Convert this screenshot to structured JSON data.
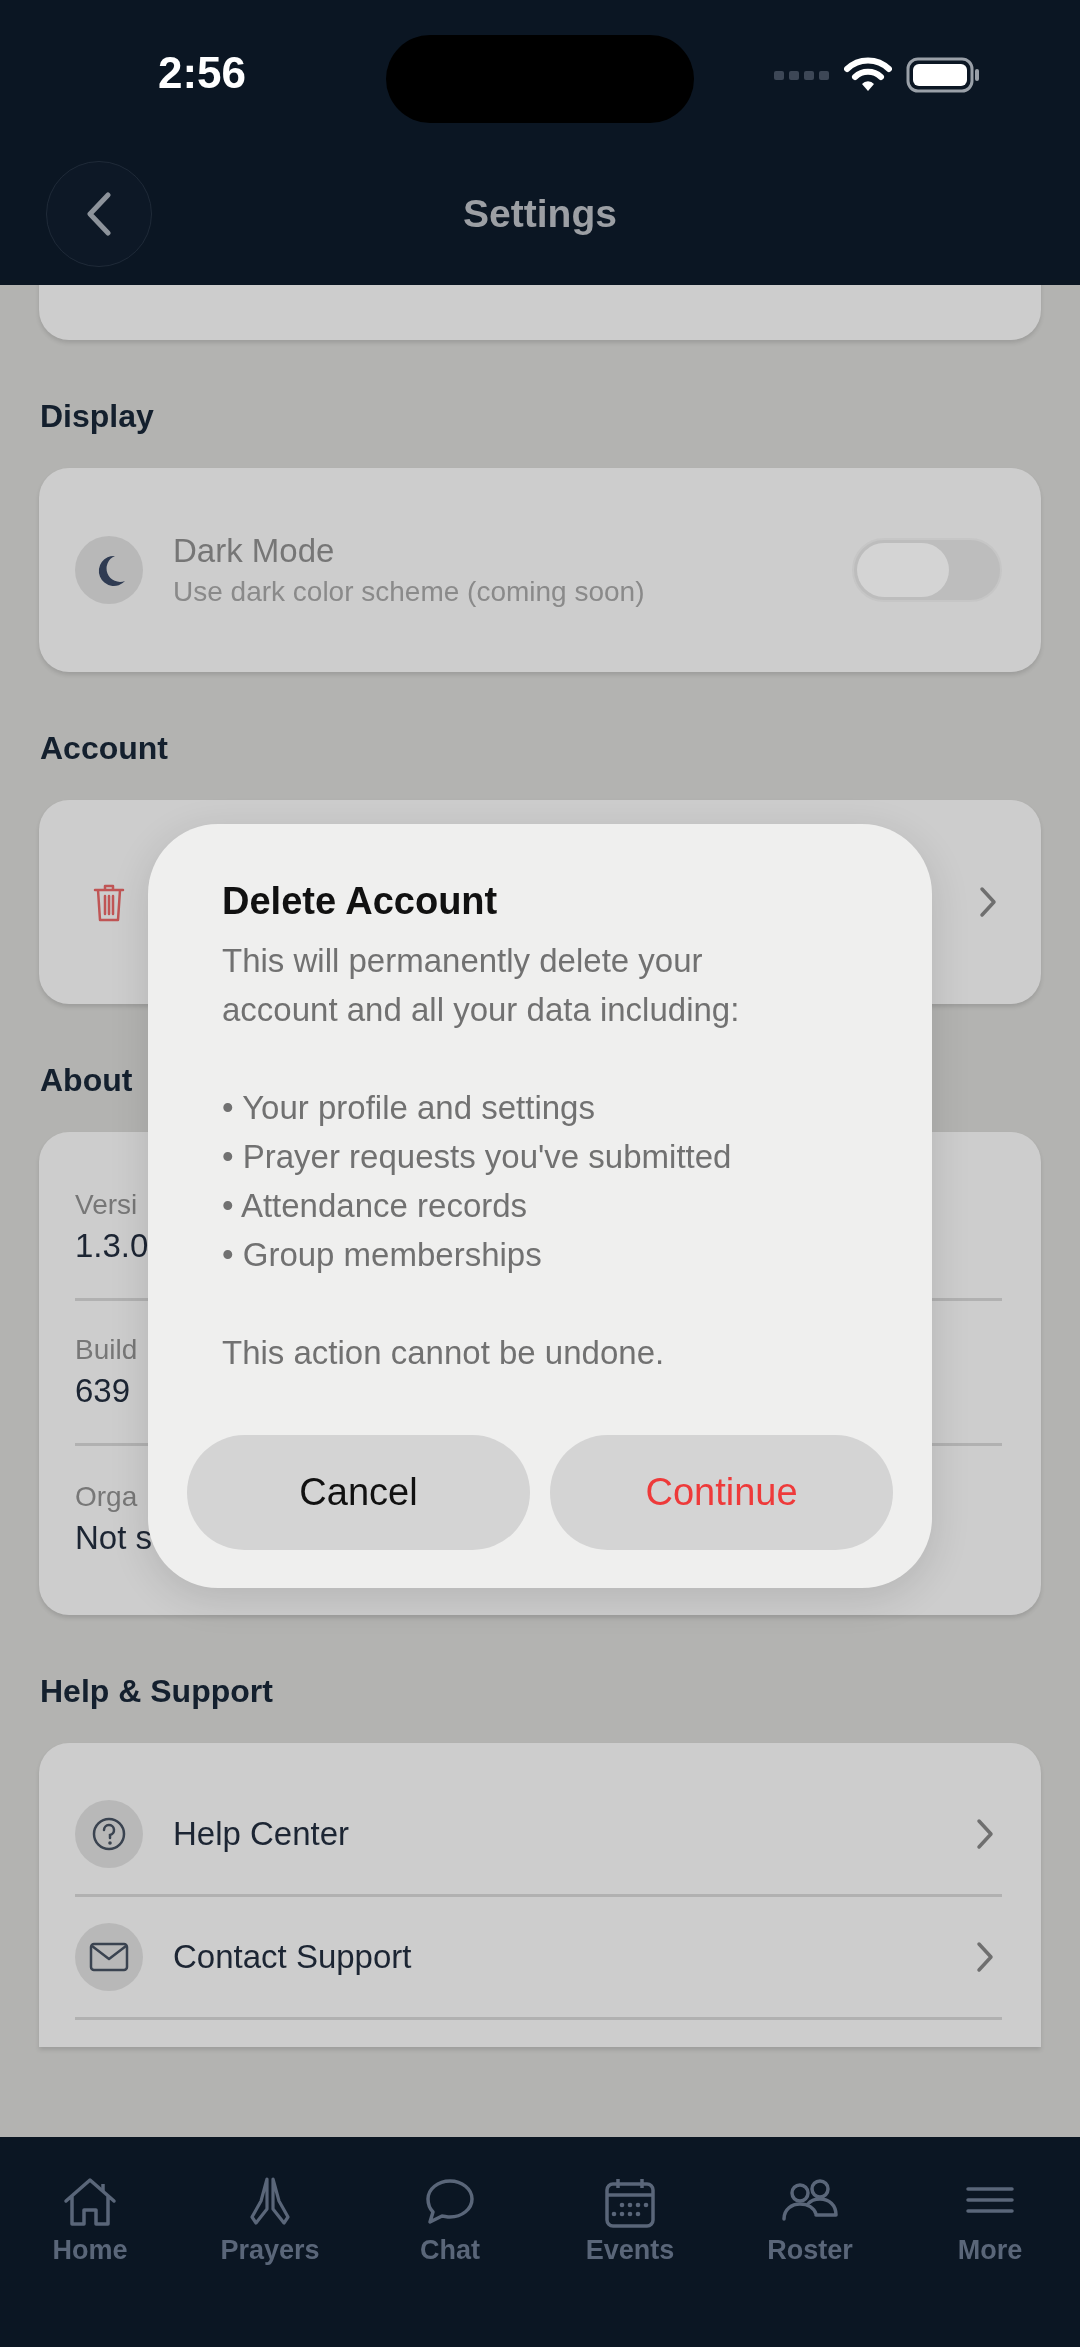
{
  "status_bar": {
    "time": "2:56"
  },
  "header": {
    "title": "Settings"
  },
  "sections": [
    {
      "heading": "Display",
      "rows": [
        {
          "kind": "toggle",
          "title": "Dark Mode",
          "subtitle": "Use dark color scheme (coming soon)",
          "on": false
        }
      ]
    },
    {
      "heading": "Account",
      "rows": [
        {
          "kind": "link",
          "danger": true
        }
      ]
    },
    {
      "heading": "About",
      "rows": [
        {
          "kind": "info",
          "label": "Versi",
          "value": "1.3.0"
        },
        {
          "kind": "info",
          "label": "Build",
          "value": "639"
        },
        {
          "kind": "info",
          "label": "Orga",
          "value": "Not s"
        }
      ]
    },
    {
      "heading": "Help & Support",
      "rows": [
        {
          "kind": "link",
          "title": "Help Center"
        },
        {
          "kind": "link",
          "title": "Contact Support"
        }
      ]
    }
  ],
  "dialog": {
    "title": "Delete Account",
    "message": "This will permanently delete your account and all your data including:",
    "bullets": [
      "• Your profile and settings",
      "• Prayer requests you've submitted",
      "• Attendance records",
      "• Group memberships"
    ],
    "note": "This action cannot be undone.",
    "buttons": [
      {
        "label": "Cancel",
        "kind": "cancel"
      },
      {
        "label": "Continue",
        "kind": "destructive"
      }
    ]
  },
  "tab_bar": [
    {
      "label": "Home"
    },
    {
      "label": "Prayers"
    },
    {
      "label": "Chat"
    },
    {
      "label": "Events"
    },
    {
      "label": "Roster"
    },
    {
      "label": "More"
    }
  ]
}
